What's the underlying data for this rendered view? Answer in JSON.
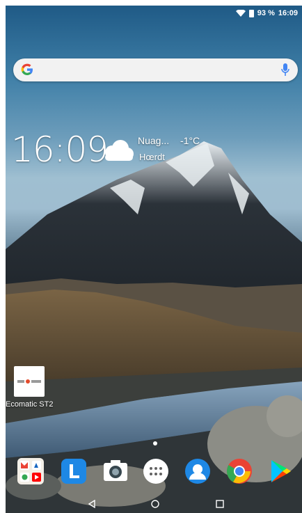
{
  "status_bar": {
    "battery": "93 %",
    "time": "16:09"
  },
  "search": {
    "placeholder": ""
  },
  "clock_widget": {
    "time": "16:09",
    "condition": "Nuag...",
    "temperature": "-1°C",
    "location": "Hœrdt"
  },
  "desktop_app": {
    "label": "Ecomatic ST2"
  },
  "dock": {
    "apps": [
      {
        "name": "google-apps-folder"
      },
      {
        "name": "lenovo-launcher"
      },
      {
        "name": "camera"
      },
      {
        "name": "app-drawer"
      },
      {
        "name": "contacts"
      },
      {
        "name": "chrome"
      },
      {
        "name": "play-store"
      }
    ]
  },
  "colors": {
    "accent_google_blue": "#4285F4",
    "sky_top": "#1f5a86"
  }
}
